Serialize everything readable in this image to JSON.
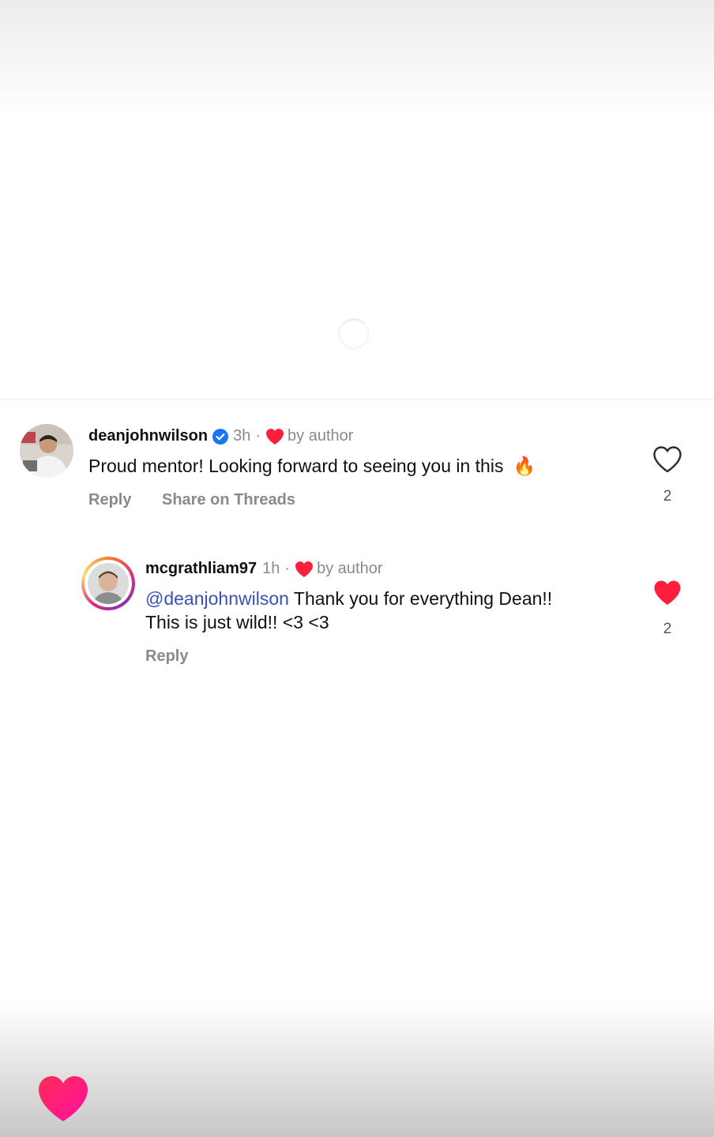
{
  "comments": [
    {
      "username": "deanjohnwilson",
      "verified": true,
      "time": "3h",
      "separator": "·",
      "liked_by_author_label": "by author",
      "text": "Proud mentor! Looking forward to seeing you in this",
      "emoji": "🔥",
      "actions": {
        "reply": "Reply",
        "share": "Share on Threads"
      },
      "like_count": "2",
      "liked": false
    },
    {
      "username": "mcgrathliam97",
      "time": "1h",
      "separator": "·",
      "liked_by_author_label": "by author",
      "mention": "@deanjohnwilson",
      "text_line1": "Thank you for everything Dean!!",
      "text_line2": "This is just wild!! <3 <3",
      "actions": {
        "reply": "Reply"
      },
      "like_count": "2",
      "liked": true
    }
  ],
  "colors": {
    "heart_red": "#ff2d55",
    "mention_blue": "#3d4fb5",
    "verified_blue": "#1877f2"
  }
}
